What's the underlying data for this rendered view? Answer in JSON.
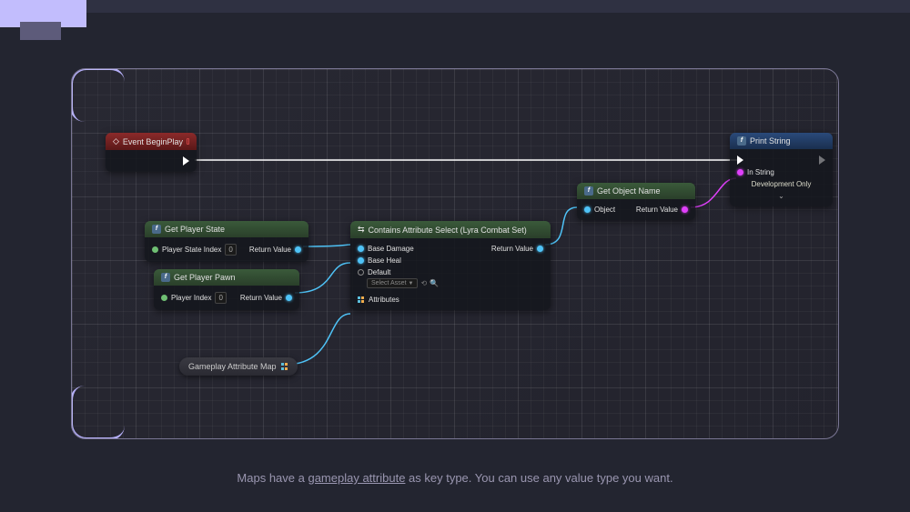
{
  "topbar": {},
  "caption": {
    "prefix": "Maps have a ",
    "link": "gameplay attribute",
    "suffix": " as key type. You can use any value type you want."
  },
  "nodes": {
    "event_beginplay": {
      "title": "Event BeginPlay"
    },
    "get_player_state": {
      "title": "Get Player State",
      "pin_index_label": "Player State Index",
      "pin_index_value": "0",
      "return_label": "Return Value"
    },
    "get_player_pawn": {
      "title": "Get Player Pawn",
      "pin_index_label": "Player Index",
      "pin_index_value": "0",
      "return_label": "Return Value"
    },
    "contains_attribute": {
      "title": "Contains Attribute Select (Lyra Combat Set)",
      "pin_base_damage": "Base Damage",
      "pin_base_heal": "Base Heal",
      "pin_default": "Default",
      "select_placeholder": "Select Asset",
      "pin_attributes": "Attributes",
      "return_label": "Return Value"
    },
    "get_object_name": {
      "title": "Get Object Name",
      "pin_object": "Object",
      "return_label": "Return Value"
    },
    "print_string": {
      "title": "Print String",
      "pin_in_string": "In String",
      "dev_only": "Development Only"
    },
    "gameplay_attribute_map": {
      "label": "Gameplay Attribute Map"
    }
  }
}
